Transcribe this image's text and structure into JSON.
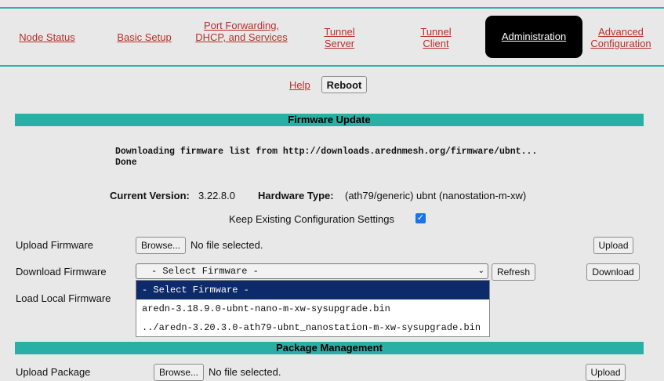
{
  "nav": {
    "node_status": "Node Status",
    "basic_setup": "Basic Setup",
    "port_forwarding": "Port Forwarding, DHCP, and Services",
    "tunnel_server": "Tunnel Server",
    "tunnel_client": "Tunnel Client",
    "administration": "Administration",
    "advanced_configuration": "Advanced Configuration"
  },
  "colors": {
    "accent": "#28b0a4",
    "link": "#b5302a",
    "active_tab": "#000000",
    "dropdown_selected": "#0d2a6b"
  },
  "header": {
    "help_label": "Help",
    "reboot_label": "Reboot"
  },
  "firmware": {
    "section_title": "Firmware Update",
    "log_line1": "Downloading firmware list from http://downloads.arednmesh.org/firmware/ubnt...",
    "log_line2": "Done",
    "current_version_label": "Current Version:",
    "current_version": "3.22.8.0",
    "hardware_type_label": "Hardware Type:",
    "hardware_type": "(ath79/generic) ubnt (nanostation-m-xw)",
    "keep_config_label": "Keep Existing Configuration Settings",
    "keep_config_checked": true,
    "upload_label": "Upload Firmware",
    "browse_label": "Browse...",
    "no_file": "No file selected.",
    "upload_button": "Upload",
    "download_label": "Download Firmware",
    "select_value": "- Select Firmware -",
    "options": [
      "- Select Firmware -",
      "aredn-3.18.9.0-ubnt-nano-m-xw-sysupgrade.bin",
      "../aredn-3.20.3.0-ath79-ubnt_nanostation-m-xw-sysupgrade.bin"
    ],
    "refresh_button": "Refresh",
    "download_button": "Download",
    "load_local_label": "Load Local Firmware"
  },
  "packages": {
    "section_title": "Package Management",
    "upload_label": "Upload Package",
    "browse_label": "Browse...",
    "no_file": "No file selected.",
    "upload_button": "Upload"
  }
}
